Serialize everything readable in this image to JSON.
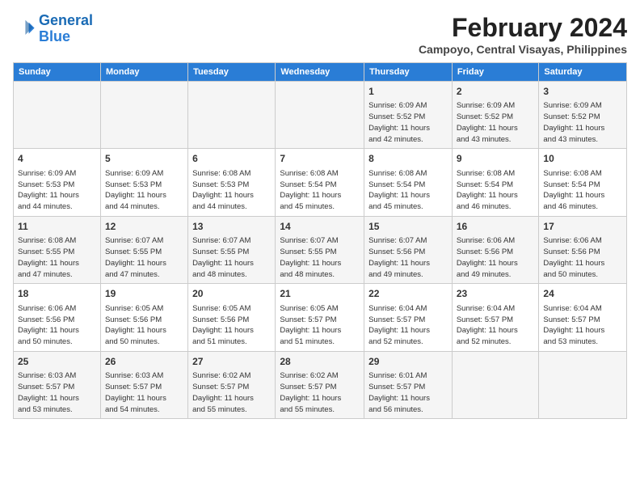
{
  "header": {
    "logo_line1": "General",
    "logo_line2": "Blue",
    "month_year": "February 2024",
    "location": "Campoyo, Central Visayas, Philippines"
  },
  "days_of_week": [
    "Sunday",
    "Monday",
    "Tuesday",
    "Wednesday",
    "Thursday",
    "Friday",
    "Saturday"
  ],
  "weeks": [
    [
      {
        "day": "",
        "info": ""
      },
      {
        "day": "",
        "info": ""
      },
      {
        "day": "",
        "info": ""
      },
      {
        "day": "",
        "info": ""
      },
      {
        "day": "1",
        "info": "Sunrise: 6:09 AM\nSunset: 5:52 PM\nDaylight: 11 hours\nand 42 minutes."
      },
      {
        "day": "2",
        "info": "Sunrise: 6:09 AM\nSunset: 5:52 PM\nDaylight: 11 hours\nand 43 minutes."
      },
      {
        "day": "3",
        "info": "Sunrise: 6:09 AM\nSunset: 5:52 PM\nDaylight: 11 hours\nand 43 minutes."
      }
    ],
    [
      {
        "day": "4",
        "info": "Sunrise: 6:09 AM\nSunset: 5:53 PM\nDaylight: 11 hours\nand 44 minutes."
      },
      {
        "day": "5",
        "info": "Sunrise: 6:09 AM\nSunset: 5:53 PM\nDaylight: 11 hours\nand 44 minutes."
      },
      {
        "day": "6",
        "info": "Sunrise: 6:08 AM\nSunset: 5:53 PM\nDaylight: 11 hours\nand 44 minutes."
      },
      {
        "day": "7",
        "info": "Sunrise: 6:08 AM\nSunset: 5:54 PM\nDaylight: 11 hours\nand 45 minutes."
      },
      {
        "day": "8",
        "info": "Sunrise: 6:08 AM\nSunset: 5:54 PM\nDaylight: 11 hours\nand 45 minutes."
      },
      {
        "day": "9",
        "info": "Sunrise: 6:08 AM\nSunset: 5:54 PM\nDaylight: 11 hours\nand 46 minutes."
      },
      {
        "day": "10",
        "info": "Sunrise: 6:08 AM\nSunset: 5:54 PM\nDaylight: 11 hours\nand 46 minutes."
      }
    ],
    [
      {
        "day": "11",
        "info": "Sunrise: 6:08 AM\nSunset: 5:55 PM\nDaylight: 11 hours\nand 47 minutes."
      },
      {
        "day": "12",
        "info": "Sunrise: 6:07 AM\nSunset: 5:55 PM\nDaylight: 11 hours\nand 47 minutes."
      },
      {
        "day": "13",
        "info": "Sunrise: 6:07 AM\nSunset: 5:55 PM\nDaylight: 11 hours\nand 48 minutes."
      },
      {
        "day": "14",
        "info": "Sunrise: 6:07 AM\nSunset: 5:55 PM\nDaylight: 11 hours\nand 48 minutes."
      },
      {
        "day": "15",
        "info": "Sunrise: 6:07 AM\nSunset: 5:56 PM\nDaylight: 11 hours\nand 49 minutes."
      },
      {
        "day": "16",
        "info": "Sunrise: 6:06 AM\nSunset: 5:56 PM\nDaylight: 11 hours\nand 49 minutes."
      },
      {
        "day": "17",
        "info": "Sunrise: 6:06 AM\nSunset: 5:56 PM\nDaylight: 11 hours\nand 50 minutes."
      }
    ],
    [
      {
        "day": "18",
        "info": "Sunrise: 6:06 AM\nSunset: 5:56 PM\nDaylight: 11 hours\nand 50 minutes."
      },
      {
        "day": "19",
        "info": "Sunrise: 6:05 AM\nSunset: 5:56 PM\nDaylight: 11 hours\nand 50 minutes."
      },
      {
        "day": "20",
        "info": "Sunrise: 6:05 AM\nSunset: 5:56 PM\nDaylight: 11 hours\nand 51 minutes."
      },
      {
        "day": "21",
        "info": "Sunrise: 6:05 AM\nSunset: 5:57 PM\nDaylight: 11 hours\nand 51 minutes."
      },
      {
        "day": "22",
        "info": "Sunrise: 6:04 AM\nSunset: 5:57 PM\nDaylight: 11 hours\nand 52 minutes."
      },
      {
        "day": "23",
        "info": "Sunrise: 6:04 AM\nSunset: 5:57 PM\nDaylight: 11 hours\nand 52 minutes."
      },
      {
        "day": "24",
        "info": "Sunrise: 6:04 AM\nSunset: 5:57 PM\nDaylight: 11 hours\nand 53 minutes."
      }
    ],
    [
      {
        "day": "25",
        "info": "Sunrise: 6:03 AM\nSunset: 5:57 PM\nDaylight: 11 hours\nand 53 minutes."
      },
      {
        "day": "26",
        "info": "Sunrise: 6:03 AM\nSunset: 5:57 PM\nDaylight: 11 hours\nand 54 minutes."
      },
      {
        "day": "27",
        "info": "Sunrise: 6:02 AM\nSunset: 5:57 PM\nDaylight: 11 hours\nand 55 minutes."
      },
      {
        "day": "28",
        "info": "Sunrise: 6:02 AM\nSunset: 5:57 PM\nDaylight: 11 hours\nand 55 minutes."
      },
      {
        "day": "29",
        "info": "Sunrise: 6:01 AM\nSunset: 5:57 PM\nDaylight: 11 hours\nand 56 minutes."
      },
      {
        "day": "",
        "info": ""
      },
      {
        "day": "",
        "info": ""
      }
    ]
  ]
}
